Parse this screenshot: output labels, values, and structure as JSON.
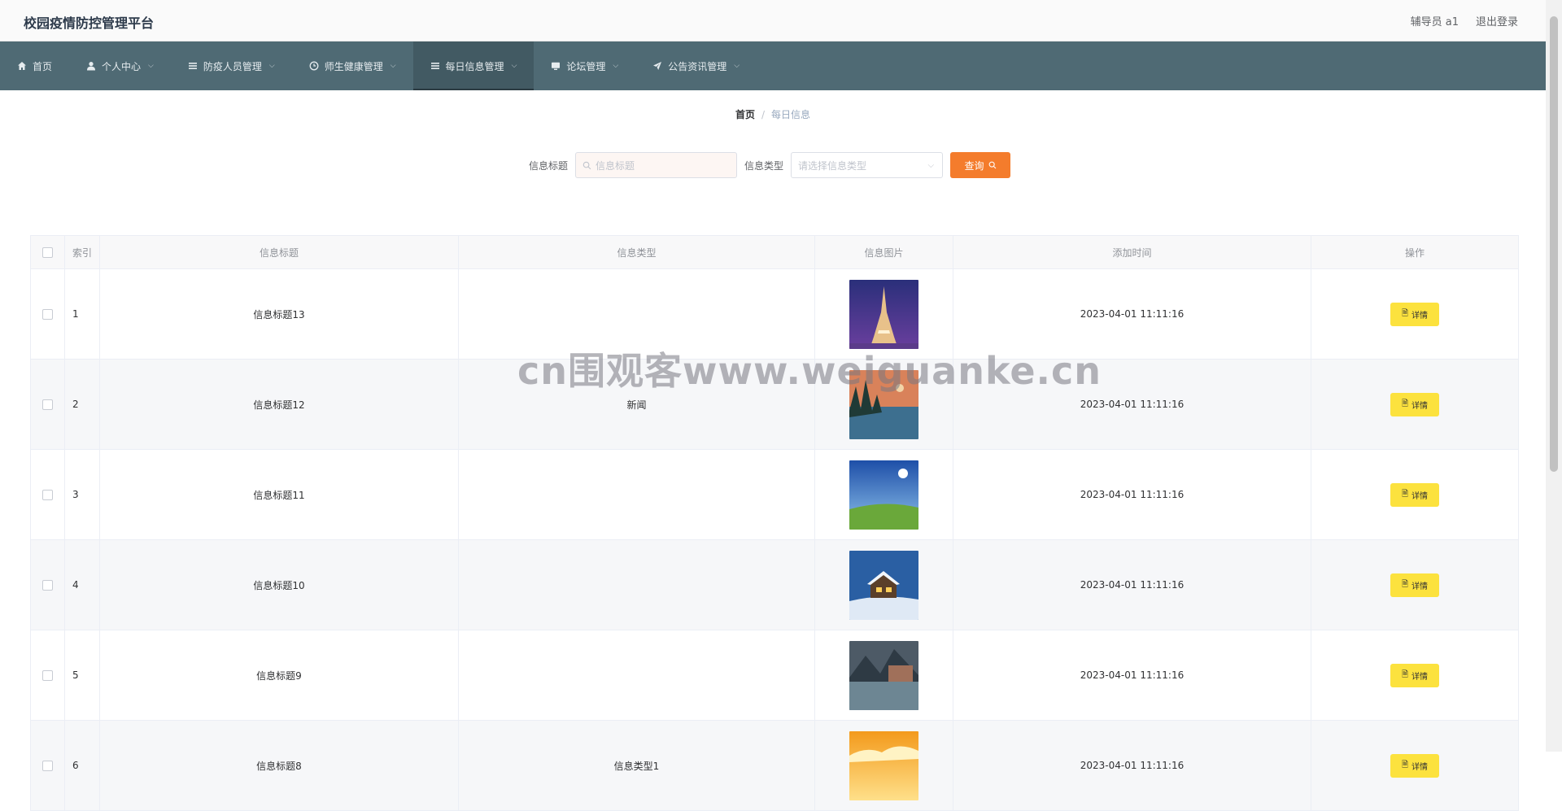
{
  "header": {
    "title": "校园疫情防控管理平台",
    "user": "辅导员 a1",
    "logout": "退出登录"
  },
  "nav": {
    "items": [
      {
        "label": "首页",
        "icon": "home-icon",
        "dropdown": false
      },
      {
        "label": "个人中心",
        "icon": "user-icon",
        "dropdown": true
      },
      {
        "label": "防疫人员管理",
        "icon": "menu-icon",
        "dropdown": true
      },
      {
        "label": "师生健康管理",
        "icon": "clock-icon",
        "dropdown": true
      },
      {
        "label": "每日信息管理",
        "icon": "menu-icon",
        "dropdown": true,
        "active": true
      },
      {
        "label": "论坛管理",
        "icon": "monitor-icon",
        "dropdown": true
      },
      {
        "label": "公告资讯管理",
        "icon": "send-icon",
        "dropdown": true
      }
    ]
  },
  "breadcrumb": {
    "home": "首页",
    "separator": "/",
    "current": "每日信息"
  },
  "search": {
    "title_label": "信息标题",
    "title_placeholder": "信息标题",
    "type_label": "信息类型",
    "type_placeholder": "请选择信息类型",
    "button": "查询"
  },
  "table": {
    "headers": [
      "索引",
      "信息标题",
      "信息类型",
      "信息图片",
      "添加时间",
      "操作"
    ],
    "rows": [
      {
        "index": "1",
        "title": "信息标题13",
        "type": "",
        "image": "eiffel-tower-night",
        "time": "2023-04-01 11:11:16",
        "action": "详情"
      },
      {
        "index": "2",
        "title": "信息标题12",
        "type": "新闻",
        "image": "lake-sunset",
        "time": "2023-04-01 11:11:16",
        "action": "详情"
      },
      {
        "index": "3",
        "title": "信息标题11",
        "type": "",
        "image": "sunny-meadow",
        "time": "2023-04-01 11:11:16",
        "action": "详情"
      },
      {
        "index": "4",
        "title": "信息标题10",
        "type": "",
        "image": "snow-cabin",
        "time": "2023-04-01 11:11:16",
        "action": "详情"
      },
      {
        "index": "5",
        "title": "信息标题9",
        "type": "",
        "image": "mountain-village",
        "time": "2023-04-01 11:11:16",
        "action": "详情"
      },
      {
        "index": "6",
        "title": "信息标题8",
        "type": "信息类型1",
        "image": "golden-sunset",
        "time": "2023-04-01 11:11:16",
        "action": "详情"
      }
    ]
  },
  "watermark": "cn围观客www.weiguanke.cn",
  "colors": {
    "nav_bg": "#4f6a74",
    "query_button": "#f47c2c",
    "detail_button": "#fce23e"
  }
}
